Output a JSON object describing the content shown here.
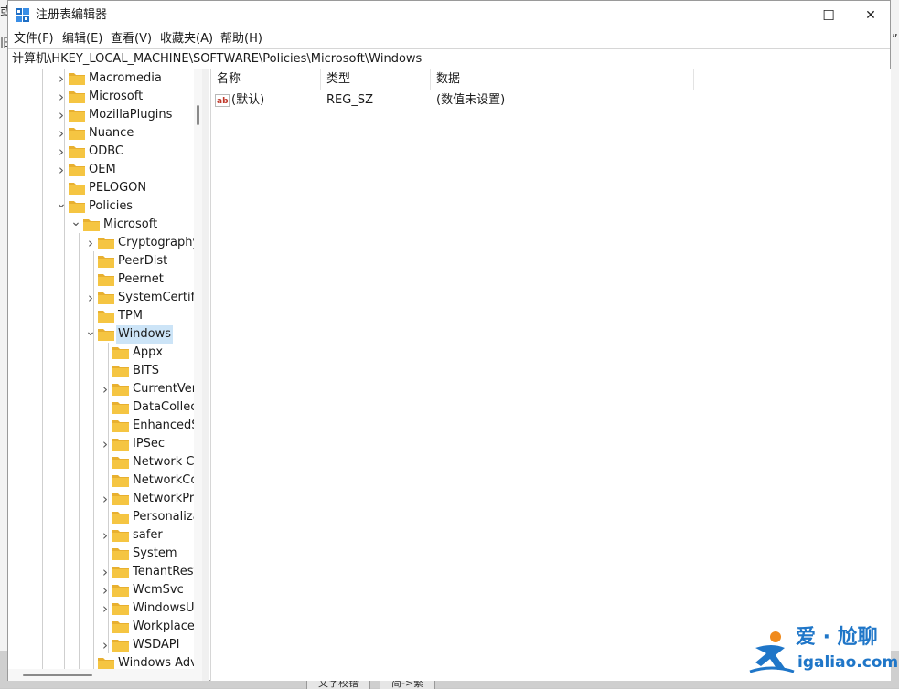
{
  "window": {
    "title": "注册表编辑器",
    "minimize_glyph": "—",
    "maximize_glyph": "☐",
    "close_glyph": "✕"
  },
  "menu": [
    "文件(F)",
    "编辑(E)",
    "查看(V)",
    "收藏夹(A)",
    "帮助(H)"
  ],
  "address": "计算机\\HKEY_LOCAL_MACHINE\\SOFTWARE\\Policies\\Microsoft\\Windows",
  "tree": [
    {
      "label": "Macromedia",
      "level": 0,
      "expander": "collapsed"
    },
    {
      "label": "Microsoft",
      "level": 0,
      "expander": "collapsed"
    },
    {
      "label": "MozillaPlugins",
      "level": 0,
      "expander": "collapsed"
    },
    {
      "label": "Nuance",
      "level": 0,
      "expander": "collapsed"
    },
    {
      "label": "ODBC",
      "level": 0,
      "expander": "collapsed"
    },
    {
      "label": "OEM",
      "level": 0,
      "expander": "collapsed"
    },
    {
      "label": "PELOGON",
      "level": 0,
      "expander": "none"
    },
    {
      "label": "Policies",
      "level": 0,
      "expander": "expanded"
    },
    {
      "label": "Microsoft",
      "level": 1,
      "expander": "expanded"
    },
    {
      "label": "Cryptography",
      "level": 2,
      "expander": "collapsed"
    },
    {
      "label": "PeerDist",
      "level": 2,
      "expander": "none"
    },
    {
      "label": "Peernet",
      "level": 2,
      "expander": "none"
    },
    {
      "label": "SystemCertificates",
      "level": 2,
      "expander": "collapsed"
    },
    {
      "label": "TPM",
      "level": 2,
      "expander": "none"
    },
    {
      "label": "Windows",
      "level": 2,
      "expander": "expanded",
      "selected": true
    },
    {
      "label": "Appx",
      "level": 3,
      "expander": "none"
    },
    {
      "label": "BITS",
      "level": 3,
      "expander": "none"
    },
    {
      "label": "CurrentVersion",
      "level": 3,
      "expander": "collapsed"
    },
    {
      "label": "DataCollection",
      "level": 3,
      "expander": "none"
    },
    {
      "label": "EnhancedStorageDevices",
      "level": 3,
      "expander": "none"
    },
    {
      "label": "IPSec",
      "level": 3,
      "expander": "collapsed"
    },
    {
      "label": "Network Connections",
      "level": 3,
      "expander": "none"
    },
    {
      "label": "NetworkConnectivityStatusIndicator",
      "level": 3,
      "expander": "none"
    },
    {
      "label": "NetworkProvider",
      "level": 3,
      "expander": "collapsed"
    },
    {
      "label": "Personalization",
      "level": 3,
      "expander": "none"
    },
    {
      "label": "safer",
      "level": 3,
      "expander": "collapsed"
    },
    {
      "label": "System",
      "level": 3,
      "expander": "none"
    },
    {
      "label": "TenantRestrictions",
      "level": 3,
      "expander": "collapsed"
    },
    {
      "label": "WcmSvc",
      "level": 3,
      "expander": "collapsed"
    },
    {
      "label": "WindowsUpdate",
      "level": 3,
      "expander": "collapsed"
    },
    {
      "label": "Workplace Join",
      "level": 3,
      "expander": "none"
    },
    {
      "label": "WSDAPI",
      "level": 3,
      "expander": "collapsed"
    },
    {
      "label": "Windows Advanced Threat Protection",
      "level": 2,
      "expander": "none"
    }
  ],
  "columns": {
    "name": "名称",
    "type": "类型",
    "data": "数据"
  },
  "values": [
    {
      "icon": "string-value-icon",
      "name": "(默认)",
      "type": "REG_SZ",
      "data": "(数值未设置)"
    }
  ],
  "background": {
    "char_1": "或",
    "char_2": "旧",
    "char_3": "”",
    "tab_1": "文字校错",
    "tab_2": "简->繁"
  },
  "watermark": {
    "cn": "爱 · 尬聊",
    "url": "igaliao.com"
  },
  "colors": {
    "selection": "#cce4f7",
    "folder": "#f5c542",
    "watermark": "#1f76c8"
  }
}
